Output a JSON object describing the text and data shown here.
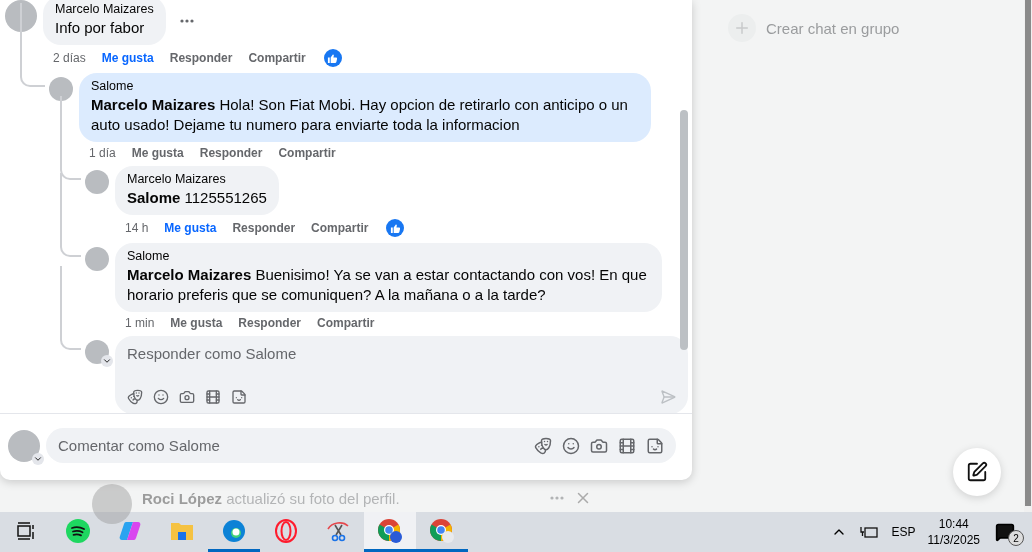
{
  "thread": {
    "comments": [
      {
        "author": "Marcelo Maizares",
        "text": "Info por fabor",
        "time": "2 días",
        "liked": true,
        "highlighted": false,
        "actions": [
          "Me gusta",
          "Responder",
          "Compartir"
        ],
        "children": [
          {
            "author": "Salome",
            "text": "**Marcelo Maizares** Hola! Son Fiat Mobi. Hay opcion de retirarlo con anticipo o un auto usado! Dejame tu numero para enviarte toda la informacion",
            "time": "1 día",
            "liked": false,
            "highlighted": true,
            "actions": [
              "Me gusta",
              "Responder",
              "Compartir"
            ],
            "children": [
              {
                "author": "Marcelo Maizares",
                "text": "**Salome** 1125551265",
                "time": "14 h",
                "liked": true,
                "highlighted": false,
                "actions": [
                  "Me gusta",
                  "Responder",
                  "Compartir"
                ]
              },
              {
                "author": "Salome",
                "text": "**Marcelo Maizares** Buenisimo! Ya se van a estar contactando con vos! En que horario preferis que se comuniquen? A la mañana o a la tarde?",
                "time": "1 min",
                "liked": false,
                "highlighted": false,
                "actions": [
                  "Me gusta",
                  "Responder",
                  "Compartir"
                ]
              }
            ],
            "reply_box": {
              "placeholder": "Responder como Salome"
            }
          }
        ]
      }
    ]
  },
  "composer": {
    "placeholder": "Comentar como Salome"
  },
  "background_notification": {
    "text": "**Roci López** actualizó su foto del perfil."
  },
  "side_panel": {
    "create_group": "Crear chat en grupo"
  },
  "taskbar": {
    "apps": [
      {
        "kind": "task-view",
        "running": false,
        "selected": false
      },
      {
        "kind": "music",
        "running": false,
        "selected": false
      },
      {
        "kind": "assistant",
        "running": false,
        "selected": false
      },
      {
        "kind": "folder",
        "running": false,
        "selected": false
      },
      {
        "kind": "edge",
        "running": true,
        "selected": false
      },
      {
        "kind": "opera",
        "running": false,
        "selected": false
      },
      {
        "kind": "snip",
        "running": false,
        "selected": false
      },
      {
        "kind": "chrome",
        "running": true,
        "selected": true
      },
      {
        "kind": "chrome-profile",
        "running": true,
        "selected": false
      }
    ],
    "tray": {
      "language": "ESP",
      "time": "10:44",
      "date": "11/3/2025",
      "notifications": "2"
    }
  }
}
